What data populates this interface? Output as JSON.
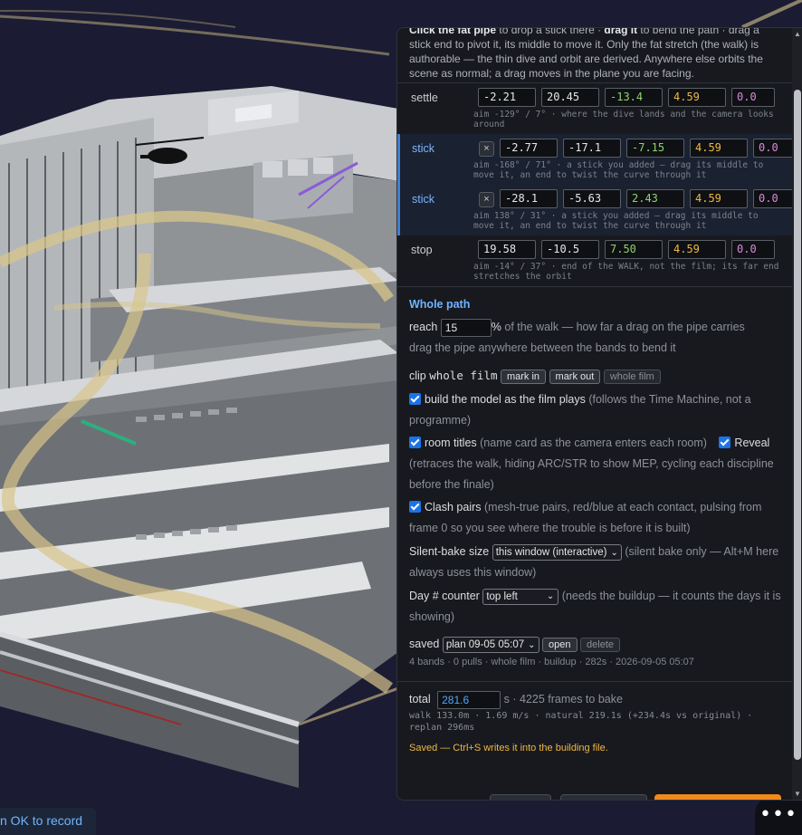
{
  "scene": {
    "record_hint": "n OK to record",
    "more_icon": "ellipsis-icon"
  },
  "intro": {
    "bold1": "Click the fat pipe",
    "t1": " to drop a stick there · ",
    "bold2": "drag it",
    "t2": " to bend the path · drag a stick end to pivot it, its middle to move it. Only the fat stretch (the walk) is authorable — the thin dive and orbit are derived. Anywhere else orbits the scene as normal; a drag moves in the plane you are facing."
  },
  "knots": [
    {
      "name": "settle",
      "removable": false,
      "x": "-2.21",
      "y": "20.45",
      "z": "-13.4",
      "h": "4.59",
      "r": "0.0",
      "note": "aim -129° / 7° · where the dive lands and the camera looks around"
    },
    {
      "name": "stick",
      "removable": true,
      "x": "-2.77",
      "y": "-17.1",
      "z": "-7.15",
      "h": "4.59",
      "r": "0.0",
      "note": "aim -168° / 71° · a stick you added — drag its middle to move it, an end to twist the curve through it"
    },
    {
      "name": "stick",
      "removable": true,
      "x": "-28.1",
      "y": "-5.63",
      "z": "2.43",
      "h": "4.59",
      "r": "0.0",
      "note": "aim 138° / 31° · a stick you added — drag its middle to move it, an end to twist the curve through it"
    },
    {
      "name": "stop",
      "removable": false,
      "x": "19.58",
      "y": "-10.5",
      "z": "7.50",
      "h": "4.59",
      "r": "0.0",
      "note": "aim -14° / 37° · end of the WALK, not the film; its far end stretches the orbit"
    }
  ],
  "remove_glyph": "×",
  "whole_path": {
    "heading": "Whole path",
    "reach_label": "reach",
    "reach_value": "15",
    "reach_unit": "%",
    "reach_desc": " of the walk — how far a drag on the pipe carries",
    "reach_hint": "drag the pipe anywhere between the bands to bend it",
    "clip_label": "clip ",
    "clip_value": "whole film",
    "mark_in": "mark in",
    "mark_out": "mark out",
    "whole_film": "whole film",
    "build_label": "build the model as the film plays",
    "build_desc": " (follows the Time Machine, not a programme)",
    "room_label": "room titles",
    "room_desc": " (name card as the camera enters each room)",
    "reveal_label": "Reveal",
    "reveal_desc": "(retraces the walk, hiding ARC/STR to show MEP, cycling each discipline before the finale)",
    "clash_label": "Clash pairs",
    "clash_desc": " (mesh-true pairs, red/blue at each contact, pulsing from frame 0 so you see where the trouble is before it is built)",
    "bake_label": "Silent-bake size",
    "bake_select": "this window (interactive)",
    "bake_desc": " (silent bake only — Alt+M here always uses this window)",
    "day_label": "Day # counter",
    "day_select": "top left",
    "day_desc": " (needs the buildup — it counts the days it is showing)",
    "saved_label": "saved",
    "saved_select": "plan 09-05 05:07",
    "open_btn": "open",
    "delete_btn": "delete",
    "saved_meta": "4 bands · 0 pulls · whole film · buildup · 282s · 2026-09-05 05:07"
  },
  "total": {
    "label": "total",
    "value": "281.6",
    "unit": "s",
    "frames": " · 4225 frames to bake",
    "stats": "walk 133.0m · 1.69 m/s · natural 219.1s (+234.4s vs original) · replan 296ms",
    "saved_msg": "Saved — Ctrl+S writes it into the building file."
  },
  "colors": {
    "accent": "#6fb3ff",
    "stick_border": "#3f7fd6",
    "warn": "#f0b840",
    "checkbox": "#1a73e8",
    "z_field": "#8fd46a",
    "roll_field": "#d98ad8",
    "primary_button": "#f08a1c"
  }
}
